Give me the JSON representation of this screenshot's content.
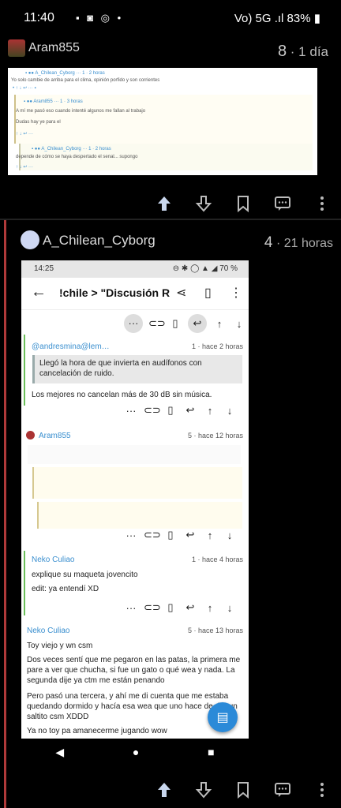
{
  "status": {
    "time": "11:40",
    "icons": "▪ ◙ ◎ •",
    "right": "Vo) 5G .ıl 83% ▮"
  },
  "post": {
    "user": "Aram855",
    "votes": "8",
    "time": "· 1 día",
    "thumb_lines": [
      "Yo solo cambie de arriba para el clima, opinión porfido y son corrientes",
      "A mí me pasó eso cuando intenté algunos me fallan al trabajo",
      "Dudas hay ye para el",
      "depende de cómo se haya despertado el senal... supongo"
    ]
  },
  "comment": {
    "user": "A_Chilean_Cyborg",
    "votes": "4",
    "time": "· 21 horas",
    "phone": {
      "status_time": "14:25",
      "status_right": "⊖ ✱ ◯ ▲ ◢ 70 %",
      "title": "!chile > \"Discusión R",
      "c1_user": "@andresmina@lem…",
      "c1_meta": "1 · hace 2 horas",
      "c1_quote": "Llegó la hora de que invierta en audífonos con cancelación de ruido.",
      "c1_text": "Los mejores no cancelan más de 30 dB sin música.",
      "c2_user": "Aram855",
      "c2_meta": "5 · hace 12 horas",
      "c3_user": "Neko Culiao",
      "c3_meta": "1 · hace 4 horas",
      "c3_text1": "explique su maqueta jovencito",
      "c3_text2": "edit: ya entendí XD",
      "c4_user": "Neko Culiao",
      "c4_meta": "5 · hace 13 horas",
      "c4_text1": "Toy viejo y wn csm",
      "c4_text2": "Dos veces sentí que me pegaron en las patas, la primera me pare a ver que chucha, si fue un gato o qué wea y nada. La segunda dije ya ctm me están penando",
      "c4_text3": "Pero pasó una tercera, y ahí me di cuenta que me estaba quedando dormido y hacía esa wea que uno hace de dar un saltito csm XDDD",
      "c4_text4": "Ya no toy pa amanecerme jugando wow"
    }
  },
  "icons": [
    "upvote-icon",
    "downvote-icon",
    "bookmark-icon",
    "reply-icon",
    "more-icon"
  ],
  "colors": {
    "accent": "#2b8ad8",
    "thread": "#b03a3a",
    "link": "#3a8fcf",
    "nested": "#6bbf59"
  }
}
